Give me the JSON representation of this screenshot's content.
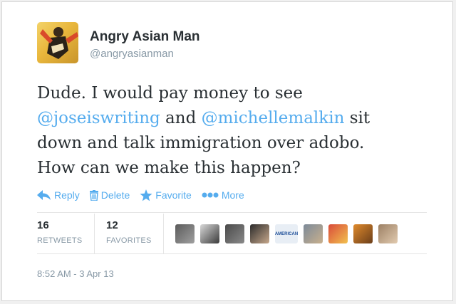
{
  "tweet": {
    "display_name": "Angry Asian Man",
    "handle": "@angryasianman",
    "text_segments": [
      "Dude. I would pay money to see",
      "@joseiswriting",
      "and",
      "@michellemalkin",
      "sit down and talk immigration over adobo. How can we make this happen?"
    ],
    "timestamp": "8:52 AM - 3 Apr 13"
  },
  "actions": {
    "reply": "Reply",
    "delete": "Delete",
    "favorite": "Favorite",
    "more": "More"
  },
  "stats": {
    "retweets_count": "16",
    "retweets_label": "RETWEETS",
    "favorites_count": "12",
    "favorites_label": "FAVORITES"
  },
  "favoriter_avatars": [
    {
      "colors": [
        "#5b5b5b",
        "#a0a0a0"
      ]
    },
    {
      "colors": [
        "#d8d8d8",
        "#3a3a3a"
      ]
    },
    {
      "colors": [
        "#4a4a4a",
        "#8a8a8a"
      ]
    },
    {
      "colors": [
        "#2b2b2b",
        "#c7a88c"
      ]
    },
    {
      "text": "AMERICAN",
      "colors": [
        "#e8eef5",
        "#1f4f99"
      ]
    },
    {
      "colors": [
        "#7c8a99",
        "#c9b08e"
      ]
    },
    {
      "colors": [
        "#d94b3a",
        "#f2c14e"
      ]
    },
    {
      "colors": [
        "#e08a2c",
        "#6b3e1a"
      ]
    },
    {
      "colors": [
        "#9c8064",
        "#e2cbb0"
      ]
    }
  ],
  "colors": {
    "link": "#55acee",
    "text": "#292f33",
    "muted": "#8899a6"
  }
}
